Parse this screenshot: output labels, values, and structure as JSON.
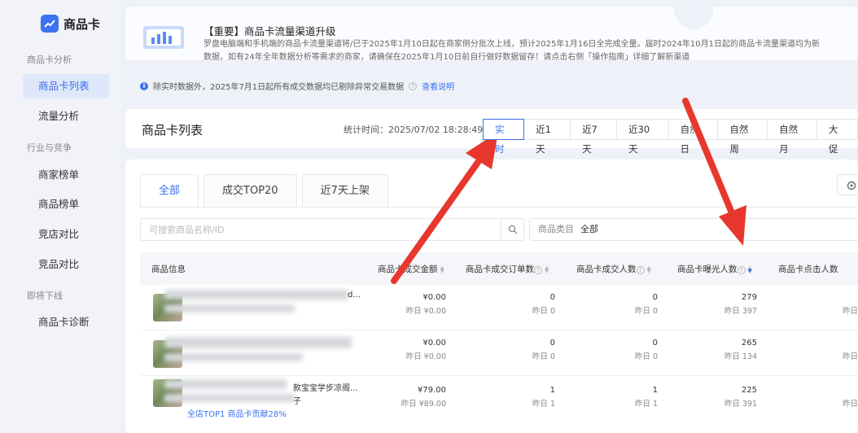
{
  "sidebar": {
    "brand": "商品卡",
    "sections": [
      {
        "title": "商品卡分析",
        "items": [
          {
            "label": "商品卡列表",
            "active": true
          },
          {
            "label": "流量分析"
          }
        ]
      },
      {
        "title": "行业与竞争",
        "items": [
          {
            "label": "商家榜单"
          },
          {
            "label": "商品榜单"
          },
          {
            "label": "竞店对比"
          },
          {
            "label": "竞品对比"
          }
        ]
      },
      {
        "title": "即将下线",
        "items": [
          {
            "label": "商品卡诊断"
          }
        ]
      }
    ]
  },
  "notice": {
    "title": "【重要】商品卡流量渠道升级",
    "body": "罗盘电脑端和手机端的商品卡流量渠道将/已于2025年1月10日起在商家侧分批次上线，预计2025年1月16日全完成全量。届时2024年10月1日起的商品卡流量渠道均为新数据，如有24年全年数据分析等需求的商家，请确保在2025年1月10日前自行做好数据留存！请点击右侧「操作指南」详细了解新渠道"
  },
  "info_line": {
    "text": "除实时数据外，2025年7月1日起所有成交数据均已剔除异常交易数据",
    "link": "查看说明"
  },
  "header": {
    "title": "商品卡列表",
    "stat_label": "统计时间：",
    "stat_time": "2025/07/02 18:28:49",
    "ranges": [
      "实时",
      "近1天",
      "近7天",
      "近30天",
      "自然日",
      "自然周",
      "自然月",
      "大促"
    ],
    "active_range": "实时"
  },
  "tabs": [
    "全部",
    "成交TOP20",
    "近7天上架"
  ],
  "search": {
    "placeholder": "可搜索商品名称/ID"
  },
  "category": {
    "label": "商品类目",
    "value": "全部"
  },
  "table": {
    "columns": [
      "商品信息",
      "商品卡成交金额",
      "商品卡成交订单数",
      "商品卡成交人数",
      "商品卡曝光人数",
      "商品卡点击人数"
    ],
    "rows": [
      {
        "name_tail": "d...",
        "amount": "¥0.00",
        "amount_y": "昨日 ¥0.00",
        "orders": "0",
        "orders_y": "昨日 0",
        "buyers": "0",
        "buyers_y": "昨日 0",
        "exposure": "279",
        "exposure_y": "昨日 397",
        "clicks_y": "昨日"
      },
      {
        "name_tail": "",
        "amount": "¥0.00",
        "amount_y": "昨日 ¥0.00",
        "orders": "0",
        "orders_y": "昨日 0",
        "buyers": "0",
        "buyers_y": "昨日 0",
        "exposure": "265",
        "exposure_y": "昨日 134",
        "clicks_y": "昨日"
      },
      {
        "name_tail": "款宝宝学步凉阁...",
        "name_tail2": "子",
        "amount": "¥79.00",
        "amount_y": "昨日 ¥89.00",
        "orders": "1",
        "orders_y": "昨日 1",
        "buyers": "1",
        "buyers_y": "昨日 1",
        "exposure": "225",
        "exposure_y": "昨日 391",
        "clicks_y": "昨日",
        "badge": "全店TOP1 商品卡贡献28%"
      }
    ]
  },
  "colors": {
    "accent": "#3b6ee8",
    "arrow": "#e8372d"
  }
}
